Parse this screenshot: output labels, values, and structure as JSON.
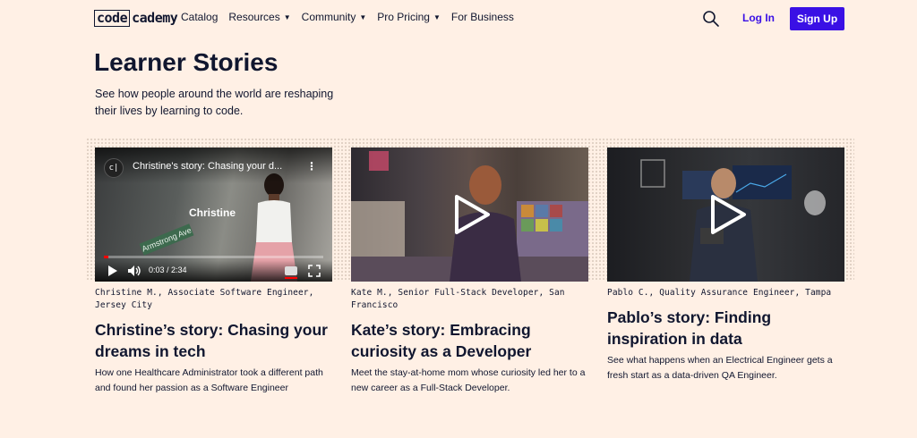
{
  "header": {
    "logo_box": "code",
    "logo_rest": "cademy",
    "nav": [
      {
        "label": "Catalog",
        "dropdown": false
      },
      {
        "label": "Resources",
        "dropdown": true
      },
      {
        "label": "Community",
        "dropdown": true
      },
      {
        "label": "Pro Pricing",
        "dropdown": true
      },
      {
        "label": "For Business",
        "dropdown": false
      }
    ],
    "login_label": "Log In",
    "signup_label": "Sign Up"
  },
  "hero": {
    "title": "Learner Stories",
    "subtitle": "See how people around the world are reshaping their lives by learning to code."
  },
  "cards": [
    {
      "meta": "Christine M., Associate Software Engineer, Jersey City",
      "title": "Christine’s story: Chasing your dreams in tech",
      "description": "How one Healthcare Administrator took a different path and found her passion as a Software Engineer",
      "video": {
        "channel_icon": "c|",
        "player_title": "Christine's story: Chasing your d...",
        "overlay_name": "Christine",
        "sign_text": "Armstrong Ave",
        "time": "0:03 / 2:34",
        "progress": 0.02
      }
    },
    {
      "meta": "Kate M., Senior Full-Stack Developer, San Francisco",
      "title": "Kate’s story: Embracing curiosity as a Developer",
      "description": "Meet the stay-at-home mom whose curiosity led her to a new career as a Full-Stack Developer."
    },
    {
      "meta": "Pablo C., Quality Assurance Engineer, Tampa",
      "title": "Pablo’s story: Finding inspiration in data",
      "description": "See what happens when an Electrical Engineer gets a fresh start as a data-driven QA Engineer."
    }
  ],
  "colors": {
    "background": "#fff0e5",
    "text": "#10162f",
    "accent": "#3a10e5"
  }
}
